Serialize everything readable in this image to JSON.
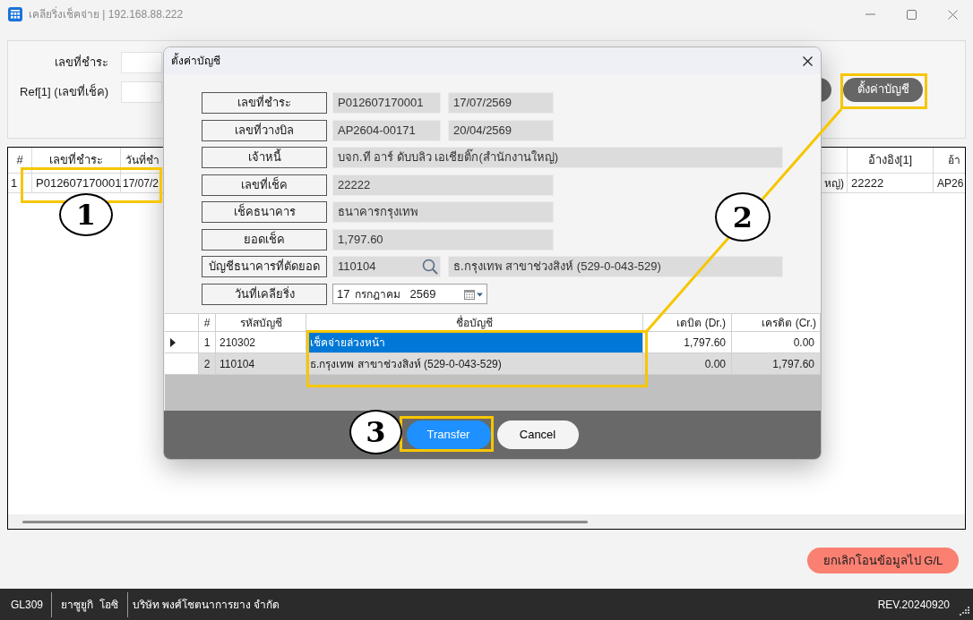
{
  "window": {
    "title": "เคลียริ่งเช็คจ่าย | 192.168.88.222"
  },
  "filter_panel": {
    "fields": [
      {
        "label": "เลขที่ชำระ"
      },
      {
        "label": "Ref[1] (เลขที่เช็ค)"
      }
    ],
    "settings_button": "ตั้งค่าบัญชี"
  },
  "table": {
    "columns": [
      {
        "header": "#"
      },
      {
        "header": "เลขที่ชำระ"
      },
      {
        "header": "วันที่ชำ"
      },
      {},
      {
        "header": "อ้างอิง[1]"
      },
      {
        "header": "อ้า"
      }
    ],
    "rows": [
      {
        "cells": [
          "1",
          "P012607170001",
          "17/07/2",
          "หญ่)",
          "22222",
          "AP26"
        ]
      }
    ]
  },
  "dialog": {
    "title": "ตั้งค่าบัญชี",
    "fields": [
      {
        "label": "เลขที่ชำระ",
        "kind": "pair",
        "values": [
          "P012607170001",
          "17/07/2569"
        ]
      },
      {
        "label": "เลขที่วางบิล",
        "kind": "pair",
        "values": [
          "AP2604-00171",
          "20/04/2569"
        ]
      },
      {
        "label": "เจ้าหนี้",
        "kind": "long",
        "values": [
          "บจก.ที อาร์ ดับบลิว เอเชียติ๊ก(สำนักงานใหญ่)"
        ]
      },
      {
        "label": "เลขที่เช็ค",
        "kind": "short",
        "values": [
          "22222"
        ]
      },
      {
        "label": "เช็คธนาคาร",
        "kind": "short",
        "values": [
          "ธนาคารกรุงเทพ"
        ]
      },
      {
        "label": "ยอดเช็ค",
        "kind": "short",
        "values": [
          "1,797.60"
        ]
      },
      {
        "label": "บัญชีธนาคารที่ตัดยอด",
        "kind": "lookup",
        "values": [
          "110104",
          "ธ.กรุงเทพ สาขาช่วงสิงห์ (529-0-043-529)"
        ]
      },
      {
        "label": "วันที่เคลียริ่ง",
        "kind": "date",
        "values": [
          "17",
          "กรกฎาคม",
          "2569"
        ]
      }
    ],
    "grid": {
      "columns": [
        "#",
        "รหัสบัญชี",
        "ชื่อบัญชี",
        "เดบิต (Dr.)",
        "เครดิต (Cr.)"
      ],
      "rows": [
        {
          "selected": true,
          "cells": [
            "1",
            "210302",
            "เช็คจ่ายล่วงหน้า",
            "1,797.60",
            "0.00"
          ]
        },
        {
          "selected": false,
          "cells": [
            "2",
            "110104",
            "ธ.กรุงเทพ สาขาช่วงสิงห์ (529-0-043-529)",
            "0.00",
            "1,797.60"
          ]
        }
      ]
    },
    "buttons": [
      {
        "label": "Transfer",
        "kind": "primary"
      },
      {
        "label": "Cancel",
        "kind": "secondary"
      }
    ]
  },
  "cancel_gl_button": "ยกเลิกโอนข้อมูลไป G/L",
  "status_bar": {
    "items": [
      "GL309",
      "ยาซูยูกิ  โอซิ",
      "บริษัท พงศ์โชตนาการยาง จำกัด"
    ],
    "version": "REV.20240920"
  },
  "annotations": [
    {
      "number": "1"
    },
    {
      "number": "2"
    },
    {
      "number": "3"
    }
  ]
}
